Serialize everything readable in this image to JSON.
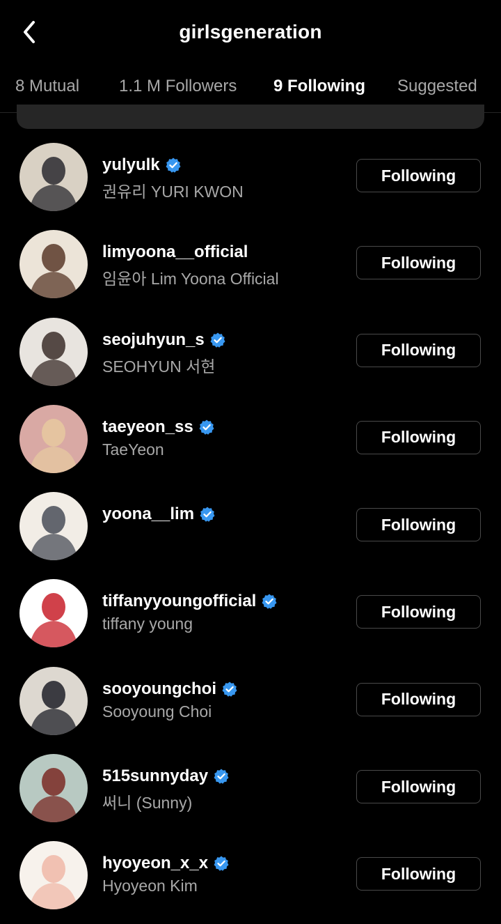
{
  "header": {
    "title": "girlsgeneration"
  },
  "tabs": [
    {
      "label": "8 Mutual"
    },
    {
      "label": "1.1 M Followers"
    },
    {
      "label": "9 Following"
    },
    {
      "label": "Suggested"
    }
  ],
  "active_tab": "9 Following",
  "follow_button_label": "Following",
  "accounts": [
    {
      "username": "yulyulk",
      "name": "권유리 YURI KWON",
      "verified": true,
      "avatar_colors": [
        "#d9d1c4",
        "#2a2a30"
      ]
    },
    {
      "username": "limyoona__official",
      "name": "임윤아 Lim Yoona Official",
      "verified": false,
      "avatar_colors": [
        "#ece4d8",
        "#5a3a2a"
      ]
    },
    {
      "username": "seojuhyun_s",
      "name": "SEOHYUN 서현",
      "verified": true,
      "avatar_colors": [
        "#e8e4df",
        "#3b2e2a"
      ]
    },
    {
      "username": "taeyeon_ss",
      "name": "TaeYeon",
      "verified": true,
      "avatar_colors": [
        "#d9a9a4",
        "#e6c9a0"
      ]
    },
    {
      "username": "yoona__lim",
      "name": "",
      "verified": true,
      "avatar_colors": [
        "#f2ede6",
        "#4a4e58"
      ]
    },
    {
      "username": "tiffanyyoungofficial",
      "name": "tiffany young",
      "verified": true,
      "avatar_colors": [
        "#ffffff",
        "#c8202a"
      ]
    },
    {
      "username": "sooyoungchoi",
      "name": "Sooyoung Choi",
      "verified": true,
      "avatar_colors": [
        "#ddd8d0",
        "#1e2028"
      ]
    },
    {
      "username": "515sunnyday",
      "name": "써니 (Sunny)",
      "verified": true,
      "avatar_colors": [
        "#b8c9c2",
        "#7a2a24"
      ]
    },
    {
      "username": "hyoyeon_x_x",
      "name": "Hyoyeon Kim",
      "verified": true,
      "avatar_colors": [
        "#f7f2ec",
        "#f0b8a8"
      ]
    }
  ],
  "colors": {
    "background": "#000000",
    "secondary_text": "#a8a8a8",
    "verified_badge": "#3897f0",
    "button_border": "#4a4a4a"
  }
}
